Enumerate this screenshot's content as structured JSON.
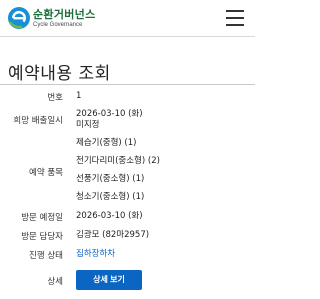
{
  "header": {
    "logo_ko": "순환거버넌스",
    "logo_en": "Cycle Governance",
    "menu_icon": "hamburger-menu-icon"
  },
  "page_title": "예약내용 조회",
  "detail": {
    "number_label": "번호",
    "number_value": "1",
    "date_label": "희망 배출일시",
    "date_value": "2026-03-10 (화)",
    "time_value": "미지정",
    "items_label": "예약 품목",
    "items": [
      "제습기(중형) (1)",
      "전기다리미(중소형) (2)",
      "선풍기(중소형) (1)",
      "청소기(중소형) (1)"
    ],
    "visit_date_label": "방문 예정일",
    "visit_date_value": "2026-03-10 (화)",
    "visitor_label": "방문 담당자",
    "visitor_value": "김광모 (82마2957)",
    "status_label": "진행 상태",
    "status_value": "집하장하차",
    "more_label": "상세",
    "more_button": "상세 보기"
  },
  "colors": {
    "brand_green": "#1b6e37",
    "button_blue": "#0a66c2",
    "link_blue": "#0a63c7"
  }
}
